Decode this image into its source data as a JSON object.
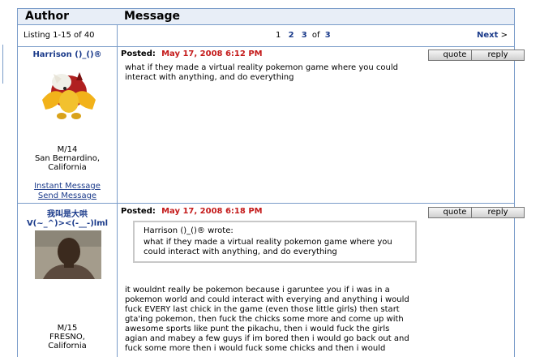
{
  "header": {
    "author_label": "Author",
    "message_label": "Message"
  },
  "listing": {
    "text": "Listing 1-15 of 40",
    "pages": [
      "1",
      "2",
      "3"
    ],
    "of_label": "of",
    "total_pages": "3",
    "next_label": "Next",
    "next_arrow": ">"
  },
  "buttons": {
    "quote": "quote",
    "reply": "reply"
  },
  "posts": [
    {
      "author": "Harrison ()_()®",
      "info1": "M/14",
      "info2": "San Bernardino,",
      "info3": "California",
      "im_link": "Instant Message",
      "send_link": "Send Message",
      "posted_label": "Posted:",
      "date": "May 17, 2008 6:12 PM",
      "message": "what if they made a virtual reality pokemon game where you could interact with anything, and do everything"
    },
    {
      "author_line1": "我叫是大哄",
      "author_line2": "V(~_^)><(-__-)lml",
      "info1": "M/15",
      "info2": "FRESNO,",
      "info3": "California",
      "posted_label": "Posted:",
      "date": "May 17, 2008 6:18 PM",
      "quote_author": "Harrison ()_()® wrote:",
      "quote_text": "what if they made a virtual reality pokemon game where you could interact with anything, and do everything",
      "message": "it wouldnt really be pokemon because i garuntee you if i was in a pokemon world and could interact with everying and anything i would fuck EVERY last chick in the game (even those little girls) then start gta'ing pokemon, then fuck the chicks some more and come up with awesome sports like punt the pikachu, then i would fuck the girls agian and mabey a few guys if im bored then i would go back out and fuck some more then i would fuck some chicks and then i would"
    }
  ],
  "colors": {
    "link": "#1a3a8a",
    "date": "#c41a1a",
    "border": "#7a9cc9",
    "header_bg": "#e8eef7"
  }
}
